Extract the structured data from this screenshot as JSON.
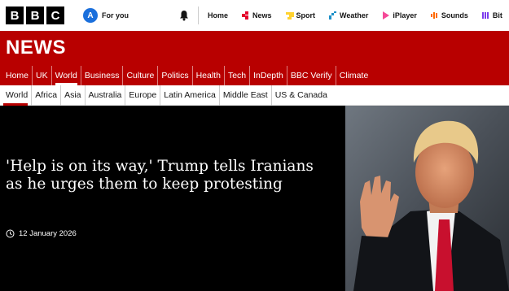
{
  "logo": {
    "letters": [
      "B",
      "B",
      "C"
    ]
  },
  "account": {
    "initial": "A",
    "label": "For you"
  },
  "topnav": [
    {
      "label": "Home",
      "icon": "home",
      "color": ""
    },
    {
      "label": "News",
      "icon": "news-icon",
      "color": "#e4002b"
    },
    {
      "label": "Sport",
      "icon": "sport-icon",
      "color": "#ffd230"
    },
    {
      "label": "Weather",
      "icon": "weather-icon",
      "color": "#1e90c8"
    },
    {
      "label": "iPlayer",
      "icon": "iplayer-icon",
      "color": "#f54997"
    },
    {
      "label": "Sounds",
      "icon": "sounds-icon",
      "color": "#ff6a00"
    },
    {
      "label": "Bit",
      "icon": "bitesize-icon",
      "color": "#7c3aed"
    }
  ],
  "header": {
    "title": "NEWS"
  },
  "mainnav": [
    "Home",
    "UK",
    "World",
    "Business",
    "Culture",
    "Politics",
    "Health",
    "Tech",
    "InDepth",
    "BBC Verify",
    "Climate"
  ],
  "mainnav_active": "World",
  "subnav": [
    "World",
    "Africa",
    "Asia",
    "Australia",
    "Europe",
    "Latin America",
    "Middle East",
    "US & Canada"
  ],
  "subnav_active": "World",
  "hero": {
    "headline": "'Help is on its way,' Trump tells Iranians as he urges them to keep protesting",
    "date": "12 January 2026"
  }
}
